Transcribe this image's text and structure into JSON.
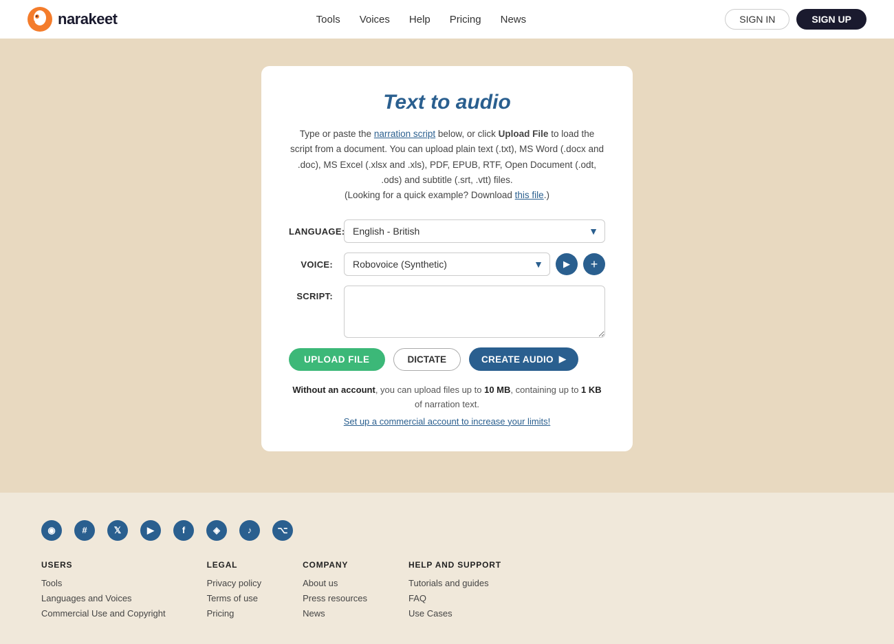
{
  "header": {
    "logo_text": "narakeet",
    "nav": [
      {
        "label": "Tools",
        "href": "#"
      },
      {
        "label": "Voices",
        "href": "#"
      },
      {
        "label": "Help",
        "href": "#"
      },
      {
        "label": "Pricing",
        "href": "#"
      },
      {
        "label": "News",
        "href": "#"
      }
    ],
    "signin_label": "SIGN IN",
    "signup_label": "SIGN UP"
  },
  "main": {
    "card": {
      "title": "Text to audio",
      "desc_part1": "Type or paste the ",
      "desc_link1": "narration script",
      "desc_part2": " below, or click ",
      "desc_bold": "Upload File",
      "desc_part3": " to load the script from a document. You can upload plain text (.txt), MS Word (.docx and .doc), MS Excel (.xlsx and .xls), PDF, EPUB, RTF, Open Document (.odt, .ods) and subtitle (.srt, .vtt) files.",
      "desc_part4": "(Looking for a quick example? Download ",
      "desc_link2": "this file",
      "desc_part5": ".)",
      "language_label": "LANGUAGE:",
      "language_value": "English - British",
      "voice_label": "VOICE:",
      "voice_value": "Robovoice (Synthetic)",
      "script_label": "SCRIPT:",
      "upload_label": "UPLOAD FILE",
      "dictate_label": "DICTATE",
      "create_label": "CREATE AUDIO",
      "note_part1": "Without an account",
      "note_part2": ", you can upload files up to ",
      "note_bold": "10 MB",
      "note_part3": ", containing up to ",
      "note_bold2": "1 KB",
      "note_part4": " of narration text.",
      "note_link": "Set up a commercial account to increase your limits!"
    }
  },
  "footer": {
    "social_icons": [
      {
        "name": "rss",
        "symbol": "◉"
      },
      {
        "name": "slack",
        "symbol": "#"
      },
      {
        "name": "twitter",
        "symbol": "𝕏"
      },
      {
        "name": "youtube",
        "symbol": "▶"
      },
      {
        "name": "facebook",
        "symbol": "f"
      },
      {
        "name": "instagram",
        "symbol": "◈"
      },
      {
        "name": "tiktok",
        "symbol": "♪"
      },
      {
        "name": "github",
        "symbol": "⌥"
      }
    ],
    "columns": [
      {
        "heading": "USERS",
        "links": [
          "Tools",
          "Languages and Voices",
          "Commercial Use and Copyright"
        ]
      },
      {
        "heading": "LEGAL",
        "links": [
          "Privacy policy",
          "Terms of use",
          "Pricing"
        ]
      },
      {
        "heading": "COMPANY",
        "links": [
          "About us",
          "Press resources",
          "News"
        ]
      },
      {
        "heading": "HELP AND SUPPORT",
        "links": [
          "Tutorials and guides",
          "FAQ",
          "Use Cases"
        ]
      }
    ]
  }
}
